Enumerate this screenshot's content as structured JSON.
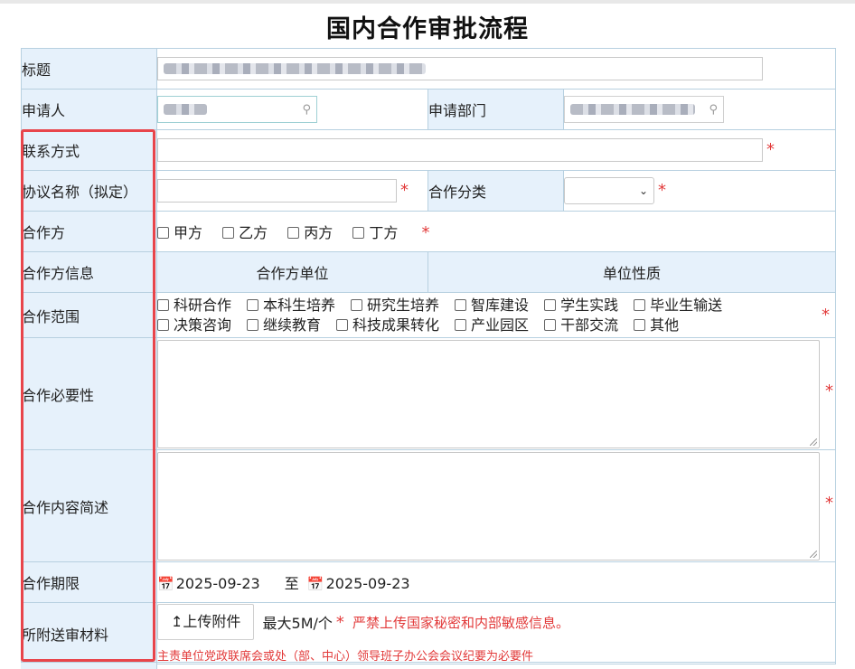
{
  "page": {
    "title": "国内合作审批流程"
  },
  "form": {
    "title_label": "标题",
    "applicant_label": "申请人",
    "department_label": "申请部门",
    "contact_label": "联系方式",
    "agreement_name_label": "协议名称（拟定）",
    "category_label": "合作分类",
    "partner_label": "合作方",
    "partner_options": [
      "甲方",
      "乙方",
      "丙方",
      "丁方"
    ],
    "partner_info_label": "合作方信息",
    "partner_info_columns": [
      "合作方单位",
      "单位性质"
    ],
    "scope_label": "合作范围",
    "scope_options_row1": [
      "科研合作",
      "本科生培养",
      "研究生培养",
      "智库建设",
      "学生实践",
      "毕业生输送"
    ],
    "scope_options_row2": [
      "决策咨询",
      "继续教育",
      "科技成果转化",
      "产业园区",
      "干部交流",
      "其他"
    ],
    "necessity_label": "合作必要性",
    "content_label": "合作内容简述",
    "period_label": "合作期限",
    "period_start": "2025-09-23",
    "period_sep": "至",
    "period_end": "2025-09-23",
    "attachments_label": "所附送审材料",
    "upload_button": "↥上传附件",
    "upload_limit": "最大5M/个",
    "upload_warning": "严禁上传国家秘密和内部敏感信息。",
    "upload_note": "主责单位党政联席会或处（部、中心）领导班子办公会会议纪要为必要件",
    "required_mark": "*"
  },
  "colors": {
    "label_bg": "#e6f1fb",
    "border": "#b7d0e0",
    "required": "#e23a3a",
    "highlight": "#e8454b"
  },
  "icons": {
    "search": "search-icon",
    "calendar": "calendar-icon",
    "chevron": "chevron-down-icon"
  }
}
